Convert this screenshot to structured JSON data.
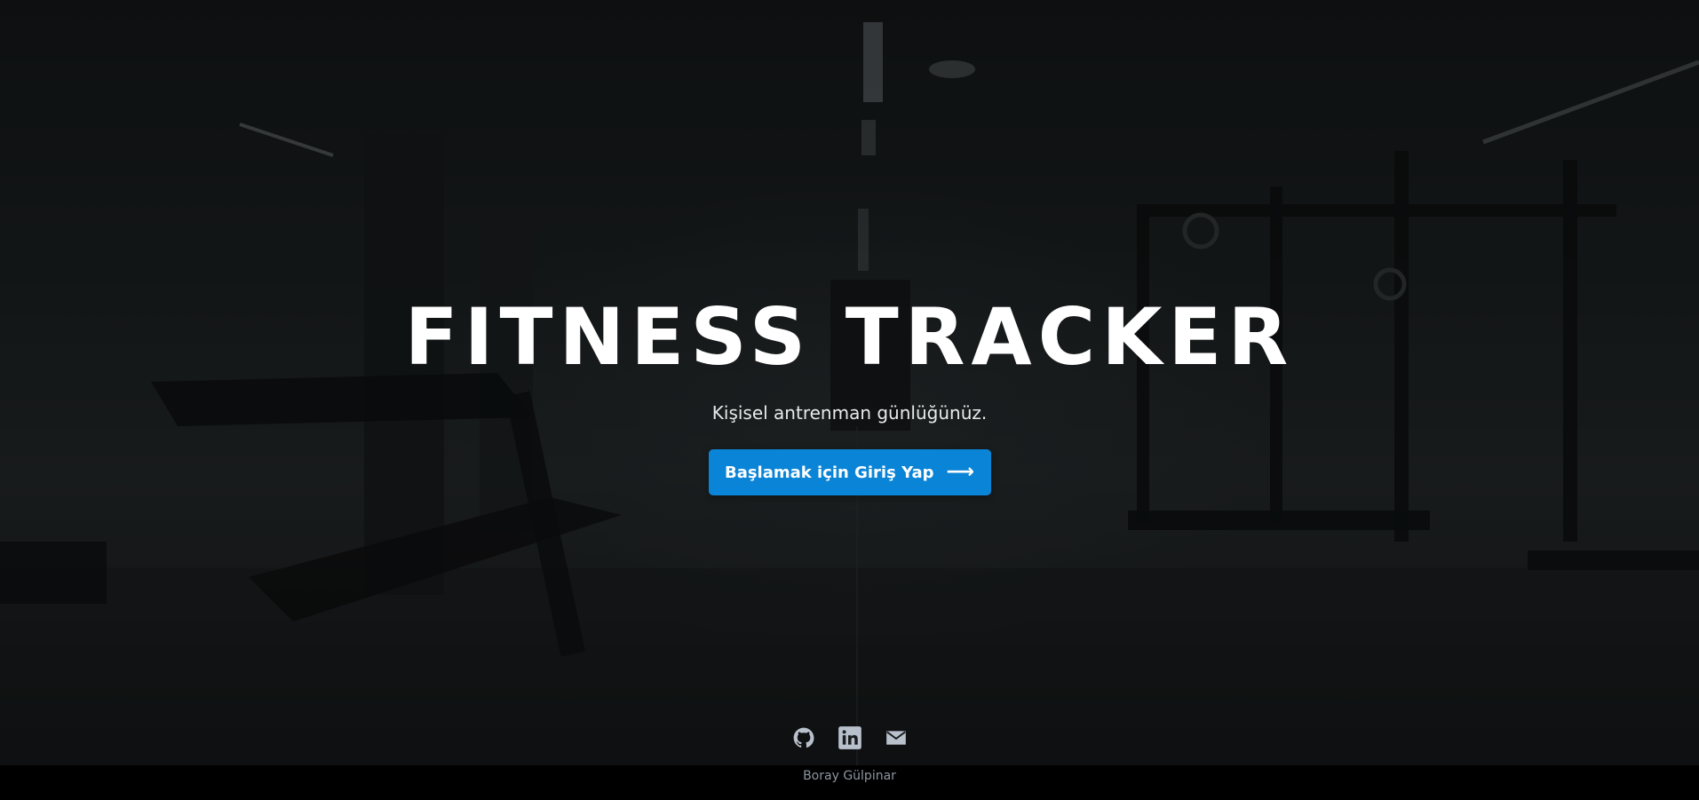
{
  "hero": {
    "title": "FITNESS TRACKER",
    "subtitle": "Kişisel antrenman günlüğünüz.",
    "cta_label": "Başlamak için Giriş Yap",
    "cta_arrow": "⟶"
  },
  "social": {
    "icons": [
      "github-icon",
      "linkedin-icon",
      "mail-icon"
    ]
  },
  "footer": {
    "author": "Boray Gülpinar"
  },
  "colors": {
    "accent": "#0a84d6",
    "footer_bg": "#000000",
    "footer_text": "#8d96a3",
    "icon": "#b8c0cc"
  }
}
